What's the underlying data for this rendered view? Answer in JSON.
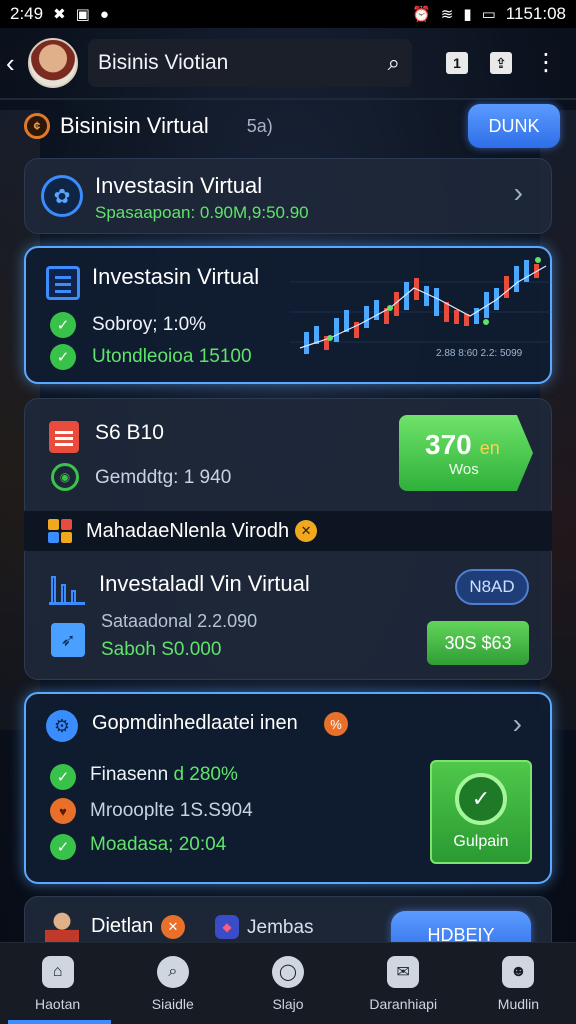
{
  "status_bar": {
    "time": "2:49",
    "right_time": "1151:08"
  },
  "header": {
    "title": "Bisinis Viotian"
  },
  "section": {
    "title": "Bisinisin Virtual",
    "subtitle": "5a)",
    "button": "DUNK"
  },
  "card1": {
    "title": "Investasin Virtual",
    "subtitle": "Spasaapoan: 0.90M,9:50.90"
  },
  "card2": {
    "title": "Investasin Virtual",
    "line1": "Sobroy; 1:0%",
    "line2": "Utondleoioa 15100",
    "chart_caption": "2.88 8:60 2.2: 5099"
  },
  "card3": {
    "amount": "S6 B10",
    "gen": "Gemddtg: 1 940",
    "cta_big": "370",
    "cta_suffix": "en",
    "cta_small": "Wos",
    "strip_title": "MahadaeNlenla Virodh",
    "inv_title": "Investaladl Vin Virtual",
    "sal": "Sataadonal 2.2.090",
    "sab": "Saboh S0.000",
    "badge": "N8AD",
    "price": "30S $63"
  },
  "card4": {
    "title": "Gopmdinhedlaatei inen",
    "row1_label": "Finasenn",
    "row1_value": "d 280%",
    "row2": "Mroooplte 1S.S904",
    "row3": "Moadasa; 20:04",
    "button": "Gulpain"
  },
  "card5": {
    "title": "Dietlan",
    "second": "Jembas",
    "button": "HDBEIY"
  },
  "nav": [
    {
      "label": "Haotan"
    },
    {
      "label": "Siaidle"
    },
    {
      "label": "Slajo"
    },
    {
      "label": "Daranhiapi"
    },
    {
      "label": "Mudlin"
    }
  ],
  "colors": {
    "accent": "#3b8cff",
    "positive": "#5fe36a",
    "warning": "#e8702a"
  }
}
